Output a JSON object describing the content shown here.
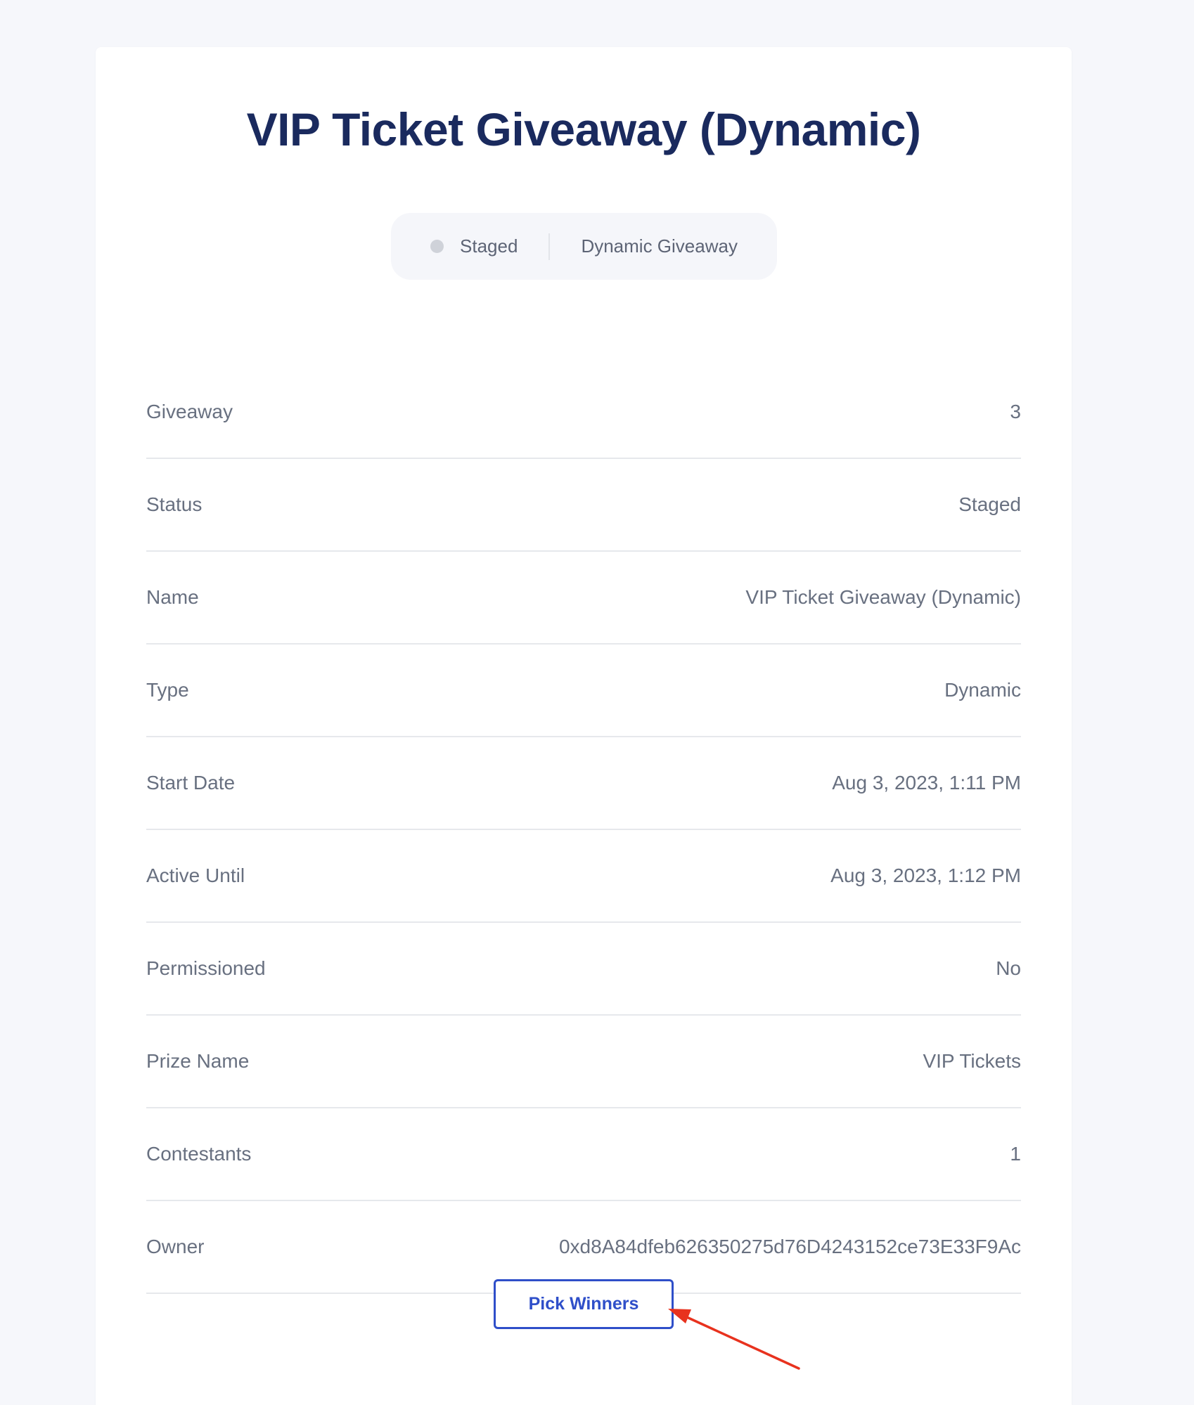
{
  "title": "VIP Ticket Giveaway (Dynamic)",
  "pill": {
    "status": "Staged",
    "type": "Dynamic Giveaway"
  },
  "details": [
    {
      "label": "Giveaway",
      "value": "3"
    },
    {
      "label": "Status",
      "value": "Staged"
    },
    {
      "label": "Name",
      "value": "VIP Ticket Giveaway (Dynamic)"
    },
    {
      "label": "Type",
      "value": "Dynamic"
    },
    {
      "label": "Start Date",
      "value": "Aug 3, 2023, 1:11 PM"
    },
    {
      "label": "Active Until",
      "value": "Aug 3, 2023, 1:12 PM"
    },
    {
      "label": "Permissioned",
      "value": "No"
    },
    {
      "label": "Prize Name",
      "value": "VIP Tickets"
    },
    {
      "label": "Contestants",
      "value": "1"
    },
    {
      "label": "Owner",
      "value": "0xd8A84dfeb626350275d76D4243152ce73E33F9Ac"
    }
  ],
  "actions": {
    "pick_winners_label": "Pick Winners"
  },
  "colors": {
    "background": "#f6f7fb",
    "title": "#1a2a5e",
    "accent": "#2f4fc9",
    "annotation_arrow": "#e8321e"
  }
}
